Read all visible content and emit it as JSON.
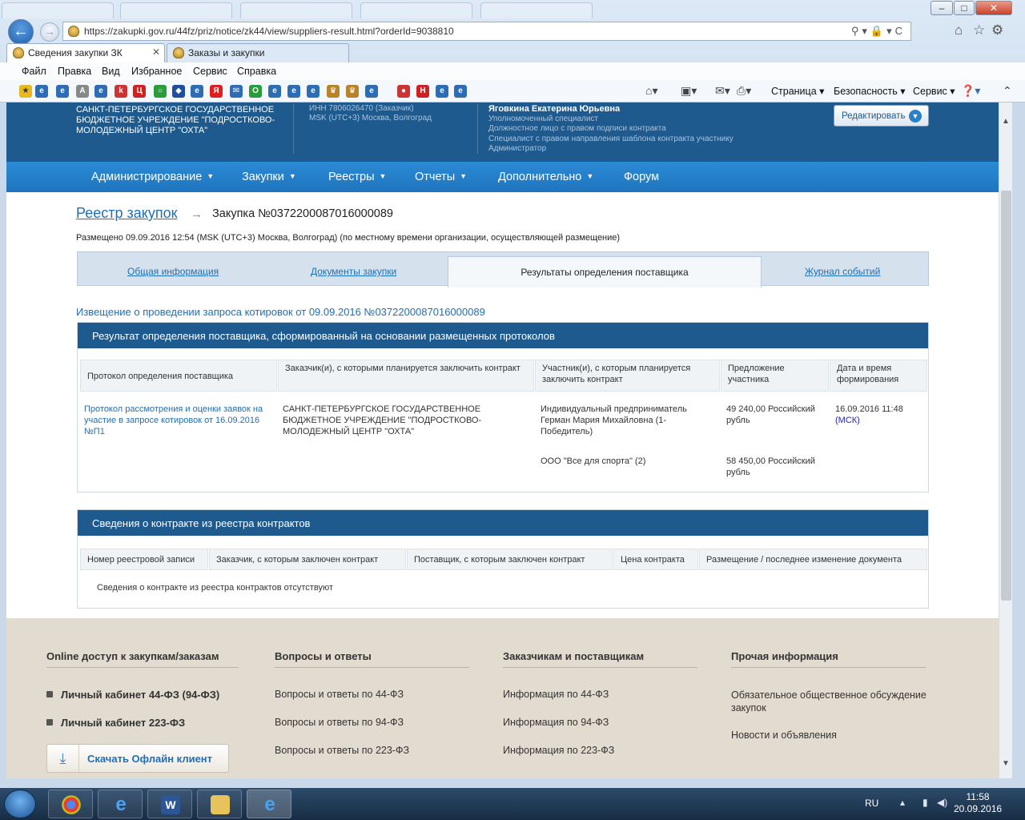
{
  "browser": {
    "url": "https://zakupki.gov.ru/44fz/priz/notice/zk44/view/suppliers-result.html?orderId=9038810",
    "tabs": [
      {
        "title": "Сведения закупки ЗК"
      },
      {
        "title": "Заказы и закупки"
      }
    ],
    "menu": [
      "Файл",
      "Правка",
      "Вид",
      "Избранное",
      "Сервис",
      "Справка"
    ],
    "command_bar": [
      "Страница",
      "Безопасность",
      "Сервис"
    ]
  },
  "header": {
    "org_name": "САНКТ-ПЕТЕРБУРГСКОЕ ГОСУДАРСТВЕННОЕ БЮДЖЕТНОЕ УЧРЕЖДЕНИЕ \"ПОДРОСТКОВО-МОЛОДЕЖНЫЙ ЦЕНТР \"ОХТА\"",
    "inn": "ИНН 7806026470 (Заказчик)",
    "timezone": "MSK (UTC+3) Москва, Волгоград",
    "user_name": "Яговкина Екатерина Юрьевна",
    "roles": [
      "Уполномоченный специалист",
      "Должностное лицо с правом подписи контракта",
      "Специалист с правом направления шаблона контракта участнику",
      "Администратор"
    ],
    "edit_button": "Редактировать"
  },
  "nav": [
    "Администрирование",
    "Закупки",
    "Реестры",
    "Отчеты",
    "Дополнительно",
    "Форум"
  ],
  "breadcrumb": {
    "registry": "Реестр закупок",
    "purchase": "Закупка №0372200087016000089"
  },
  "posted": "Размещено 09.09.2016 12:54 (MSK (UTC+3) Москва, Волгоград) (по местному времени организации, осуществляющей размещение)",
  "tabs": [
    "Общая информация",
    "Документы закупки",
    "Результаты определения поставщика",
    "Журнал событий"
  ],
  "notice_link": "Извещение о проведении запроса котировок от 09.09.2016 №0372200087016000089",
  "result_panel": {
    "title": "Результат определения поставщика, сформированный на основании размещенных протоколов",
    "headers": [
      "Протокол определения поставщика",
      "Заказчик(и), с которыми планируется заключить контракт",
      "Участник(и), с которым планируется заключить контракт",
      "Предложение участника",
      "Дата и время формирования"
    ],
    "protocol": "Протокол рассмотрения и оценки заявок на участие в запросе котировок от 16.09.2016 №П1",
    "customer": "САНКТ-ПЕТЕРБУРГСКОЕ ГОСУДАРСТВЕННОЕ БЮДЖЕТНОЕ УЧРЕЖДЕНИЕ \"ПОДРОСТКОВО-МОЛОДЕЖНЫЙ ЦЕНТР \"ОХТА\"",
    "participants": [
      {
        "name": "Индивидуальный предприниматель Герман Мария Михайловна (1-Победитель)",
        "offer": "49 240,00 Российский рубль"
      },
      {
        "name": "ООО \"Все для спорта\" (2)",
        "offer": "58 450,00 Российский рубль"
      }
    ],
    "date": "16.09.2016 11:48",
    "date_tz": "(МСК)"
  },
  "contract_panel": {
    "title": "Сведения о контракте из реестра контрактов",
    "headers": [
      "Номер реестровой записи",
      "Заказчик, с которым заключен контракт",
      "Поставщик, с которым заключен контракт",
      "Цена контракта",
      "Размещение / последнее изменение документа"
    ],
    "empty": "Сведения о контракте из реестра контрактов отсутствуют"
  },
  "footer": {
    "col1": {
      "title": "Online доступ к закупкам/заказам",
      "items": [
        "Личный кабинет 44-ФЗ (94-ФЗ)",
        "Личный кабинет 223-ФЗ"
      ],
      "download": "Скачать Офлайн клиент"
    },
    "col2": {
      "title": "Вопросы и ответы",
      "items": [
        "Вопросы и ответы по 44-ФЗ",
        "Вопросы и ответы по 94-ФЗ",
        "Вопросы и ответы по 223-ФЗ"
      ]
    },
    "col3": {
      "title": "Заказчикам и поставщикам",
      "items": [
        "Информация по 44-ФЗ",
        "Информация по 94-ФЗ",
        "Информация по 223-ФЗ"
      ]
    },
    "col4": {
      "title": "Прочая информация",
      "items": [
        "Обязательное общественное обсуждение закупок",
        "Новости и объявления"
      ]
    }
  },
  "taskbar": {
    "lang": "RU",
    "time": "11:58",
    "date": "20.09.2016"
  }
}
